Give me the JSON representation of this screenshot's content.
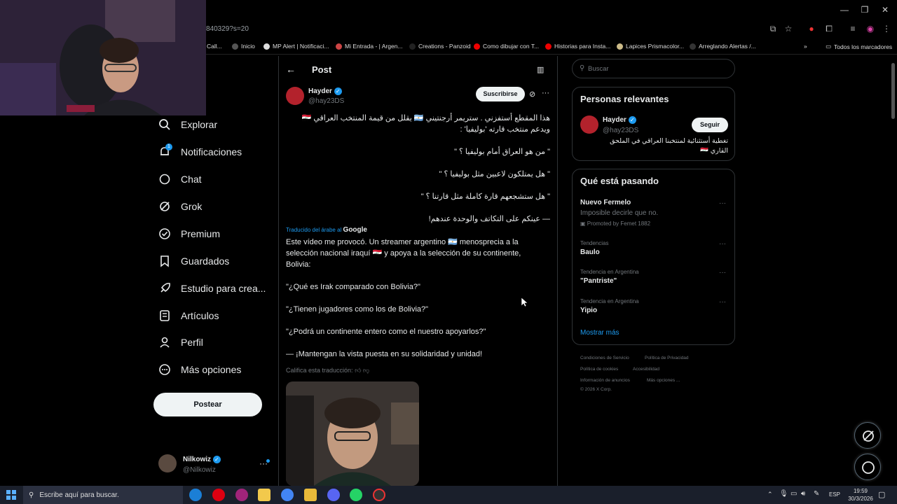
{
  "browser": {
    "url": "840329?s=20",
    "bookmarks": [
      "Call...",
      "Inicio",
      "MP Alert | Notificaci...",
      "Mi Entrada - | Argen...",
      "Creations - Panzoid",
      "Como dibujar con T...",
      "Historias para Insta...",
      "Lapices Prismacolor...",
      "Arreglando Alertas /..."
    ],
    "all_bookmarks": "Todos los marcadores"
  },
  "nav": {
    "items": [
      "Explorar",
      "Notificaciones",
      "Chat",
      "Grok",
      "Premium",
      "Guardados",
      "Estudio para crea...",
      "Artículos",
      "Perfil",
      "Más opciones"
    ],
    "notif_badge": "1",
    "post_button": "Postear",
    "account": {
      "name": "Nilkowiz",
      "handle": "@Nilkowiz"
    }
  },
  "post": {
    "header": "Post",
    "author": {
      "name": "Hayder",
      "handle": "@hay23DS"
    },
    "subscribe": "Suscribirse",
    "arabic": [
      "هذا المقطع أستفزني . ستريمر أرجنتيني 🇦🇷 يقلل من قيمة المنتخب العراقي 🇮🇶",
      "ويدعم منتخب قارته 'بوليفيا' :",
      "\" من هو العراق أمام بوليفيا ؟ \"",
      "\" هل يمتلكون لاعبين مثل بوليفيا ؟ \"",
      "\" هل ستشجعهم قارة كاملة مثل قارتنا ؟ \"",
      "— عينكم على التكاتف والوحدة عندهم!"
    ],
    "translated_by": "Traducido del árabe al",
    "translator": "Google",
    "spanish": [
      "Este vídeo me provocó. Un streamer argentino 🇦🇷 menosprecia a la",
      "selección nacional iraquí 🇮🇶 y apoya a la selección de su continente,",
      "Bolivia:",
      "\"¿Qué es Irak comparado con Bolivia?\"",
      "\"¿Tienen jugadores como los de Bolivia?\"",
      "\"¿Podrá un continente entero como el nuestro apoyarlos?\"",
      "— ¡Mantengan la vista puesta en su solidaridad y unidad!"
    ],
    "rate_translation": "Califica esta traducción:"
  },
  "sidebar": {
    "search_placeholder": "Buscar",
    "relevant_title": "Personas relevantes",
    "relevant_person": {
      "name": "Hayder",
      "handle": "@hay23DS",
      "bio": "تغطية أستثنائية لمنتخبنا العراقي في الملحق القاري 🇮🇶",
      "follow": "Seguir"
    },
    "happening_title": "Qué está pasando",
    "trends": [
      {
        "meta": "",
        "title": "Nuevo Fermelo",
        "sub": "Imposible decirle que no.",
        "promo": "Promoted by Femet 1882"
      },
      {
        "meta": "Tendencias",
        "title": "Baulo"
      },
      {
        "meta": "Tendencia en Argentina",
        "title": "\"Pantriste\""
      },
      {
        "meta": "Tendencia en Argentina",
        "title": "Yipio"
      }
    ],
    "show_more": "Mostrar más",
    "footer": [
      "Condiciones de Servicio",
      "Política de Privacidad",
      "Política de cookies",
      "Accesibilidad",
      "Información de anuncios",
      "Más opciones ...",
      "© 2026 X Corp."
    ]
  },
  "taskbar": {
    "search_placeholder": "Escribe aquí para buscar.",
    "lang": "ESP",
    "time": "19:59",
    "date": "30/3/2026"
  },
  "colors": {
    "accent": "#1d9bf0",
    "border": "#2f3336",
    "muted": "#71767b"
  }
}
